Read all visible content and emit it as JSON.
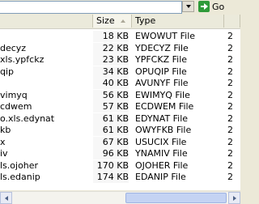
{
  "address": {
    "value": "",
    "go_label": "Go"
  },
  "columns": {
    "name": "",
    "size": "Size",
    "type": "Type",
    "extra": ""
  },
  "files": [
    {
      "name": "",
      "size": "18 KB",
      "type": "EWOWUT File",
      "date": "2"
    },
    {
      "name": "decyz",
      "size": "22 KB",
      "type": "YDECYZ File",
      "date": "2"
    },
    {
      "name": "xls.ypfckz",
      "size": "23 KB",
      "type": "YPFCKZ File",
      "date": "2"
    },
    {
      "name": "qip",
      "size": "34 KB",
      "type": "OPUQIP File",
      "date": "2"
    },
    {
      "name": "",
      "size": "40 KB",
      "type": "AVUNYF File",
      "date": "2"
    },
    {
      "name": "vimyq",
      "size": "56 KB",
      "type": "EWIMYQ File",
      "date": "2"
    },
    {
      "name": "cdwem",
      "size": "57 KB",
      "type": "ECDWEM File",
      "date": "2"
    },
    {
      "name": "o.xls.edynat",
      "size": "61 KB",
      "type": "EDYNAT File",
      "date": "2"
    },
    {
      "name": "kb",
      "size": "61 KB",
      "type": "OWYFKB File",
      "date": "2"
    },
    {
      "name": "x",
      "size": "67 KB",
      "type": "USUCIX File",
      "date": "2"
    },
    {
      "name": "iv",
      "size": "96 KB",
      "type": "YNAMIV File",
      "date": "2"
    },
    {
      "name": "ls.ojoher",
      "size": "170 KB",
      "type": "OJOHER File",
      "date": "2"
    },
    {
      "name": "ls.edanip",
      "size": "174 KB",
      "type": "EDANIP File",
      "date": "2"
    }
  ]
}
